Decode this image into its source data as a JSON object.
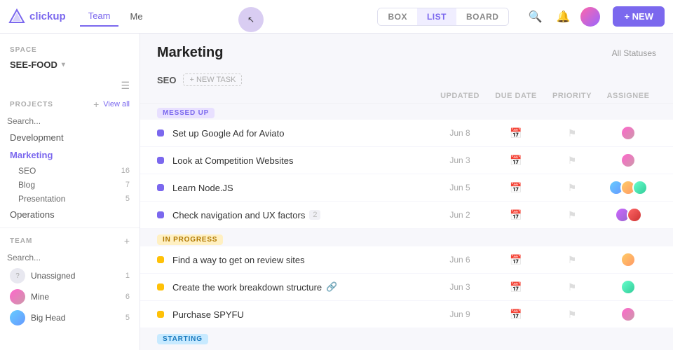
{
  "topnav": {
    "logo_text": "clickup",
    "nav_tabs": [
      "Team",
      "Me"
    ],
    "active_tab": "Team",
    "view_btns": [
      "BOX",
      "LIST",
      "BOARD"
    ],
    "active_view": "LIST",
    "new_btn_label": "+ NEW"
  },
  "sidebar": {
    "space_label": "SPACE",
    "space_name": "SEE-FOOD",
    "projects_label": "PROJECTS",
    "view_all": "View all",
    "search_placeholder": "Search...",
    "items": [
      {
        "label": "Development",
        "active": false
      },
      {
        "label": "Marketing",
        "active": true
      },
      {
        "label": "SEO",
        "sub": true,
        "count": "16"
      },
      {
        "label": "Blog",
        "sub": true,
        "count": "7"
      },
      {
        "label": "Presentation",
        "sub": true,
        "count": "5"
      },
      {
        "label": "Operations",
        "active": false
      }
    ],
    "team_label": "TEAM",
    "team_search_placeholder": "Search...",
    "members": [
      {
        "name": "Unassigned",
        "count": "1"
      },
      {
        "name": "Mine",
        "count": "6"
      },
      {
        "name": "Big Head",
        "count": "5"
      }
    ]
  },
  "main": {
    "page_title": "Marketing",
    "all_status_label": "All Statuses",
    "section_name": "SEO",
    "new_task_label": "+ NEW TASK",
    "table_headers": {
      "updated": "UPDATED",
      "due_date": "DUE DATE",
      "priority": "PRIORITY",
      "assignee": "ASSIGNEE"
    },
    "groups": [
      {
        "status": "MESSED UP",
        "status_type": "messed-up",
        "tasks": [
          {
            "name": "Set up Google Ad for Aviato",
            "updated": "Jun 8",
            "dot": "purple",
            "has_icon": false
          },
          {
            "name": "Look at Competition Websites",
            "updated": "Jun 3",
            "dot": "purple",
            "has_icon": false
          },
          {
            "name": "Learn Node.JS",
            "updated": "Jun 5",
            "dot": "purple",
            "has_icon": false
          },
          {
            "name": "Check navigation and UX factors",
            "updated": "Jun 2",
            "dot": "purple",
            "has_icon": true
          }
        ]
      },
      {
        "status": "IN PROGRESS",
        "status_type": "in-progress",
        "tasks": [
          {
            "name": "Find a way to get on review sites",
            "updated": "Jun 6",
            "dot": "yellow",
            "has_icon": false
          },
          {
            "name": "Create the work breakdown structure",
            "updated": "Jun 3",
            "dot": "yellow",
            "has_icon": true
          },
          {
            "name": "Purchase SPYFU",
            "updated": "Jun 9",
            "dot": "yellow",
            "has_icon": false
          }
        ]
      },
      {
        "status": "STARTING",
        "status_type": "starting",
        "tasks": []
      }
    ]
  }
}
